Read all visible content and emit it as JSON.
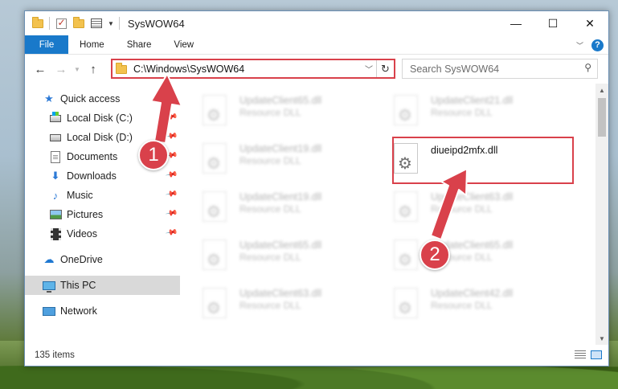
{
  "window": {
    "title": "SysWOW64",
    "controls": {
      "minimize": "—",
      "maximize": "☐",
      "close": "✕"
    }
  },
  "ribbon": {
    "file_tab": "File",
    "tabs": [
      "Home",
      "Share",
      "View"
    ],
    "help": "?"
  },
  "address_bar": {
    "path": "C:\\Windows\\SysWOW64",
    "refresh_icon": "refresh-icon"
  },
  "search": {
    "placeholder": "Search SysWOW64"
  },
  "nav_pane": {
    "quick_access": "Quick access",
    "items": [
      {
        "label": "Local Disk (C:)",
        "icon": "drive-c-icon",
        "pinned": true
      },
      {
        "label": "Local Disk (D:)",
        "icon": "drive-d-icon",
        "pinned": true
      },
      {
        "label": "Documents",
        "icon": "documents-icon",
        "pinned": true
      },
      {
        "label": "Downloads",
        "icon": "downloads-icon",
        "pinned": true
      },
      {
        "label": "Music",
        "icon": "music-icon",
        "pinned": true
      },
      {
        "label": "Pictures",
        "icon": "pictures-icon",
        "pinned": true
      },
      {
        "label": "Videos",
        "icon": "videos-icon",
        "pinned": true
      }
    ],
    "onedrive": "OneDrive",
    "this_pc": "This PC",
    "network": "Network"
  },
  "files": [
    {
      "name": "UpdateClient65.dll",
      "type": "Resource DLL"
    },
    {
      "name": "UpdateClient21.dll",
      "type": "Resource DLL"
    },
    {
      "name": "UpdateClient19.dll",
      "type": "Resource DLL"
    },
    {
      "name": "diueipd2mfx.dll",
      "type": ""
    },
    {
      "name": "UpdateClient19.dll",
      "type": "Resource DLL"
    },
    {
      "name": "UpdateClient63.dll",
      "type": "Resource DLL"
    },
    {
      "name": "UpdateClient65.dll",
      "type": "Resource DLL"
    },
    {
      "name": "UpdateClient65.dll",
      "type": "Resource DLL"
    },
    {
      "name": "UpdateClient63.dll",
      "type": "Resource DLL"
    },
    {
      "name": "UpdateClient42.dll",
      "type": "Resource DLL"
    }
  ],
  "status": {
    "item_count": "135 items"
  },
  "annotations": {
    "step1": "1",
    "step2": "2",
    "color": "#d9414b"
  }
}
